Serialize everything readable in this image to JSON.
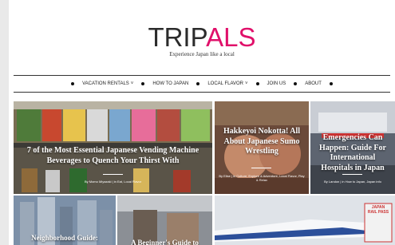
{
  "brand": {
    "logo_trip": "TRIP",
    "logo_pals": "ALS",
    "tagline": "Experience Japan like a local"
  },
  "nav": {
    "items": [
      "VACATION RENTALS",
      "HOW TO JAPAN",
      "LOCAL FLAVOR",
      "JOIN US",
      "ABOUT"
    ]
  },
  "posts": [
    {
      "title": "7 of the Most Essential Japanese Vending Machine Beverages to Quench Your Thirst With",
      "meta": "By Momo Miyazaki | in Eat, Local Flavor"
    },
    {
      "title": "Hakkeyoi Nokotta! All About Japanese Sumo Wrestling",
      "meta": "By Elise | in Culture, Explore & Adventure, Local Flavor, Play & Relax"
    },
    {
      "title": "Emergencies Can Happen: Guide For International Hospitals in Japan",
      "meta": "By Landon | in How to Japan, Japan info"
    },
    {
      "title": "Neighborhood Guide:"
    },
    {
      "title": "A Beginner's Guide to"
    }
  ],
  "poster": {
    "line1": "JAPAN",
    "line2": "RAIL PASS"
  },
  "colors": {
    "accent": "#e0106a"
  }
}
